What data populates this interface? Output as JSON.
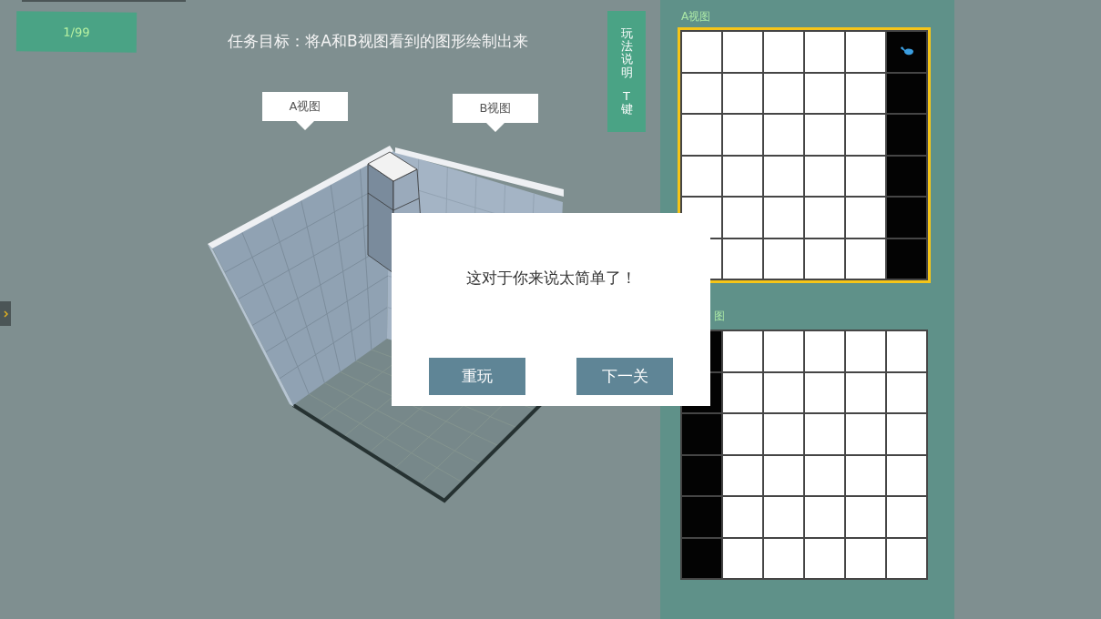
{
  "level_badge": "1/99",
  "task_title": "任务目标：将A和B视图看到的图形绘制出来",
  "view_callouts": [
    "A视图",
    "B视图"
  ],
  "help_button": {
    "lines": [
      "玩法说明",
      "T键"
    ]
  },
  "grids": [
    {
      "label": "A视图",
      "selected": true,
      "rows": [
        [
          false,
          false,
          false,
          false,
          false,
          true
        ],
        [
          false,
          false,
          false,
          false,
          false,
          true
        ],
        [
          false,
          false,
          false,
          false,
          false,
          true
        ],
        [
          false,
          false,
          false,
          false,
          false,
          true
        ],
        [
          false,
          false,
          false,
          false,
          false,
          true
        ],
        [
          false,
          false,
          false,
          false,
          false,
          true
        ]
      ]
    },
    {
      "label": "图",
      "selected": false,
      "rows": [
        [
          true,
          false,
          false,
          false,
          false,
          false
        ],
        [
          true,
          false,
          false,
          false,
          false,
          false
        ],
        [
          true,
          false,
          false,
          false,
          false,
          false
        ],
        [
          true,
          false,
          false,
          false,
          false,
          false
        ],
        [
          true,
          false,
          false,
          false,
          false,
          false
        ],
        [
          true,
          false,
          false,
          false,
          false,
          false
        ]
      ]
    }
  ],
  "dialog": {
    "message": "这对于你来说太简单了！",
    "buttons": [
      "重玩",
      "下一关"
    ]
  }
}
